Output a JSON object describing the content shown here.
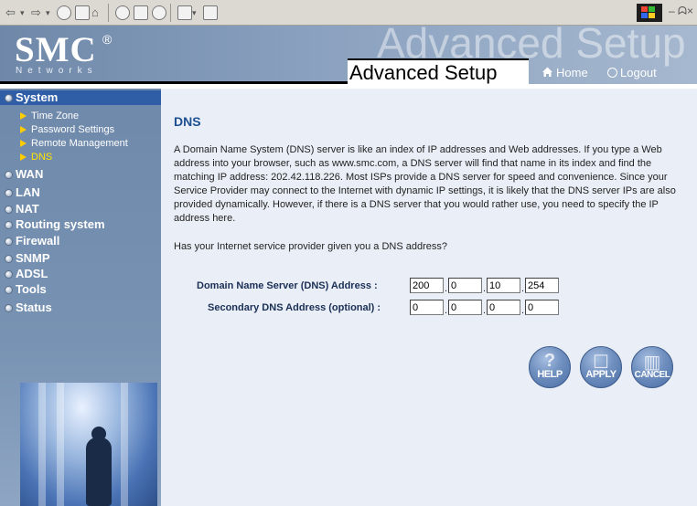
{
  "toolbar": {
    "icons": [
      "back-icon",
      "forward-icon",
      "stop-icon",
      "refresh-icon",
      "home-icon",
      "search-icon",
      "favorites-icon",
      "history-icon",
      "mail-icon",
      "print-icon"
    ],
    "window_controls": [
      "–",
      "🗗",
      "✕"
    ]
  },
  "header": {
    "logo": "SMC",
    "logo_mark": "®",
    "networks": "Networks",
    "ghost_text": "Advanced Setup",
    "title": "Advanced Setup",
    "home_label": "Home",
    "logout_label": "Logout"
  },
  "sidebar": {
    "system": "System",
    "sub_items": [
      "Time Zone",
      "Password Settings",
      "Remote Management",
      "DNS"
    ],
    "items": [
      "WAN",
      "LAN",
      "NAT",
      "Routing system",
      "Firewall",
      "SNMP",
      "ADSL",
      "Tools",
      "Status"
    ]
  },
  "main": {
    "title": "DNS",
    "description": "A Domain Name System (DNS) server is like an index of IP addresses and Web addresses. If you type a Web address into your browser, such as www.smc.com, a DNS server will find that name in its index and find the matching IP address: 202.42.118.226. Most ISPs provide a DNS server for speed and convenience. Since your Service Provider may connect to the Internet with dynamic IP settings, it is likely that the DNS server IPs are also provided dynamically. However, if there is a DNS server that you would rather use, you need to specify the IP address here.",
    "question": "Has your Internet service provider given you a DNS address?",
    "primary_label": "Domain Name Server (DNS) Address :",
    "secondary_label": "Secondary DNS Address (optional) :",
    "primary_dns": [
      "200",
      "0",
      "10",
      "254"
    ],
    "secondary_dns": [
      "0",
      "0",
      "0",
      "0"
    ],
    "dot": "."
  },
  "buttons": {
    "help": "HELP",
    "apply": "APPLY",
    "cancel": "CANCEL"
  }
}
